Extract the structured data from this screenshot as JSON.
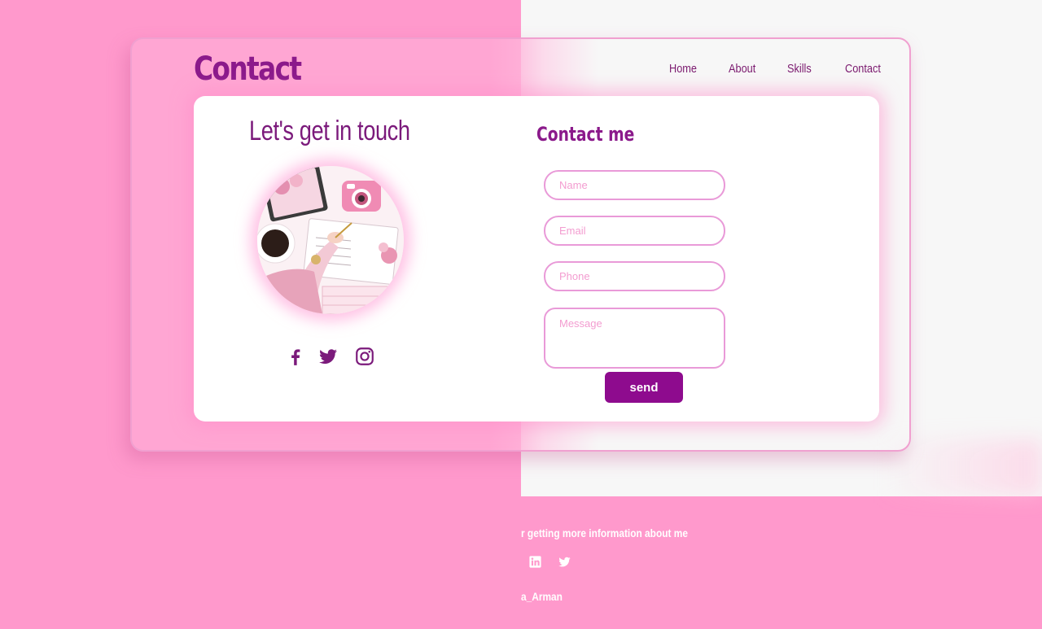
{
  "header": {
    "title": "Contact",
    "nav": [
      "Home",
      "About",
      "Skills",
      "Contact"
    ]
  },
  "left_panel": {
    "heading": "Let's get in touch",
    "illustration": "desk-flatlay-illustration",
    "socials": [
      "facebook-icon",
      "twitter-icon",
      "instagram-icon"
    ]
  },
  "form": {
    "heading": "Contact me",
    "name_placeholder": "Name",
    "email_placeholder": "Email",
    "phone_placeholder": "Phone",
    "message_placeholder": "Message",
    "send_label": "send"
  },
  "footer": {
    "text": "r getting more information about me",
    "icons": [
      "linkedin-icon",
      "twitter-icon"
    ],
    "handle": "a_Arman"
  },
  "colors": {
    "accent": "#8e0b8e",
    "pink_bg": "#ff99cc",
    "title": "#8b1a8b",
    "field_border": "#e99ad8"
  }
}
